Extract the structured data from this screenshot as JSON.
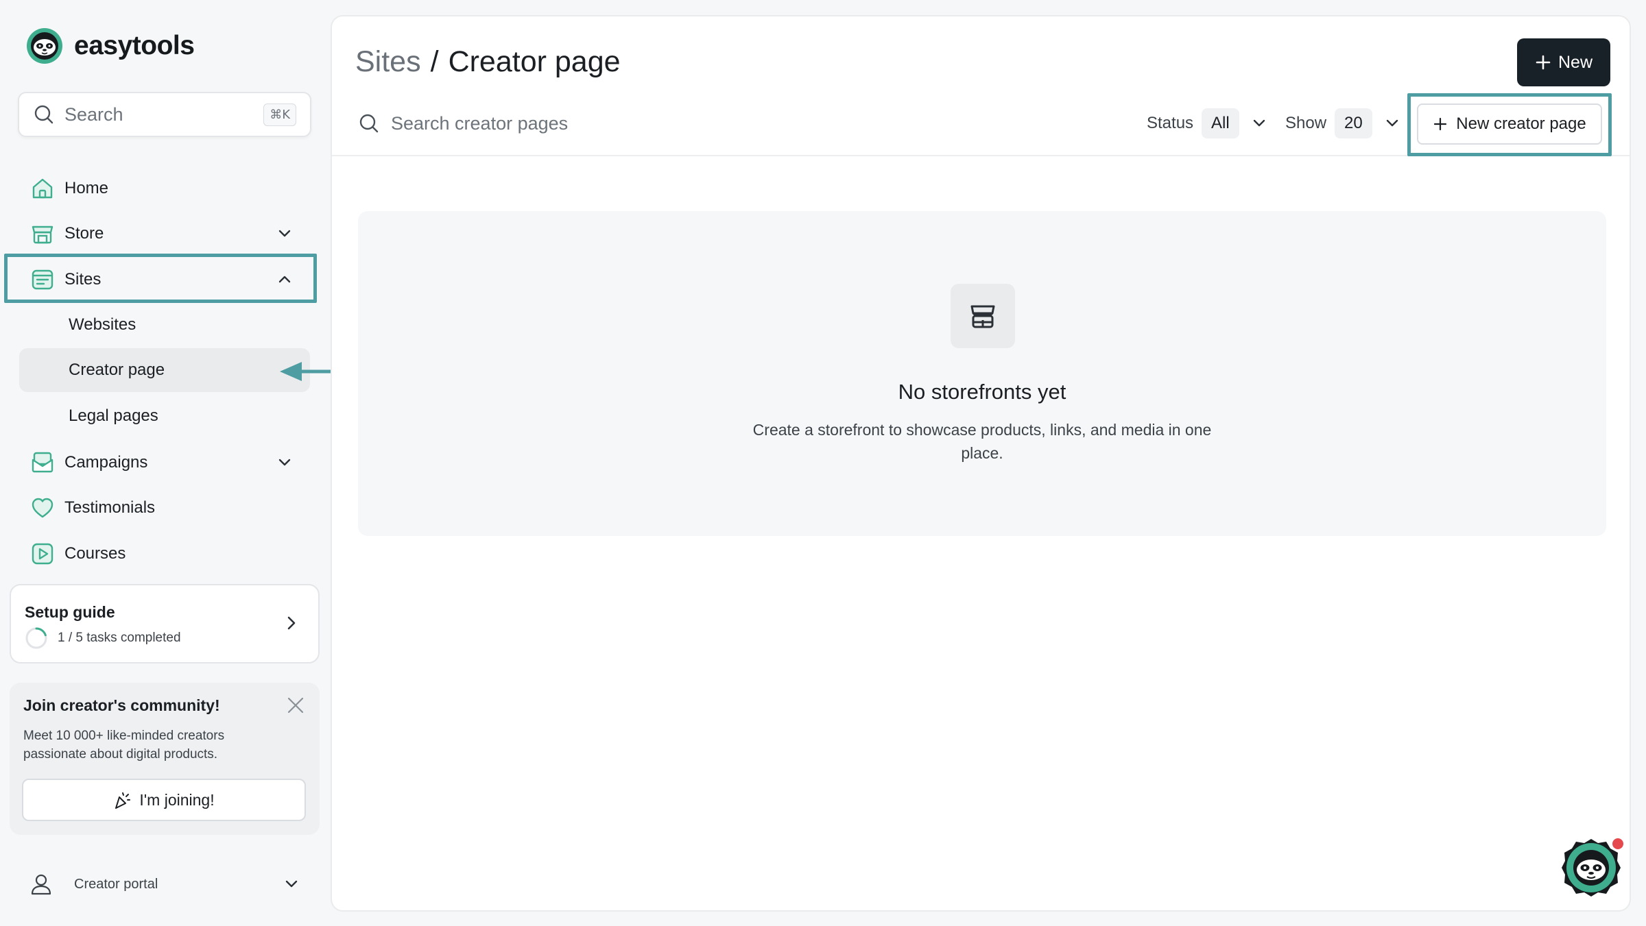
{
  "app": {
    "name": "easytools"
  },
  "search": {
    "placeholder": "Search",
    "shortcut": "⌘K"
  },
  "nav": {
    "home": "Home",
    "store": "Store",
    "sites": "Sites",
    "sites_children": [
      "Websites",
      "Creator page",
      "Legal pages"
    ],
    "campaigns": "Campaigns",
    "testimonials": "Testimonials",
    "courses": "Courses"
  },
  "setup_guide": {
    "title": "Setup guide",
    "progress_text": "1 / 5 tasks completed",
    "completed": 1,
    "total": 5
  },
  "community": {
    "title": "Join creator's community!",
    "description": "Meet 10 000+ like-minded creators passionate about digital products.",
    "button": "I'm joining!"
  },
  "portal": {
    "label": "Creator portal"
  },
  "main": {
    "breadcrumb_parent": "Sites",
    "breadcrumb_sep": "/",
    "breadcrumb_current": "Creator page",
    "new_button": "New",
    "search_placeholder": "Search creator pages",
    "status_label": "Status",
    "status_value": "All",
    "show_label": "Show",
    "show_value": "20",
    "new_creator_page_button": "New creator page",
    "empty_title": "No storefronts yet",
    "empty_description": "Create a storefront to showcase products, links, and media in one place."
  },
  "colors": {
    "accent": "#4d9da3",
    "brand_green": "#3fae8e",
    "primary_button": "#182028",
    "notification": "#e5484d"
  }
}
